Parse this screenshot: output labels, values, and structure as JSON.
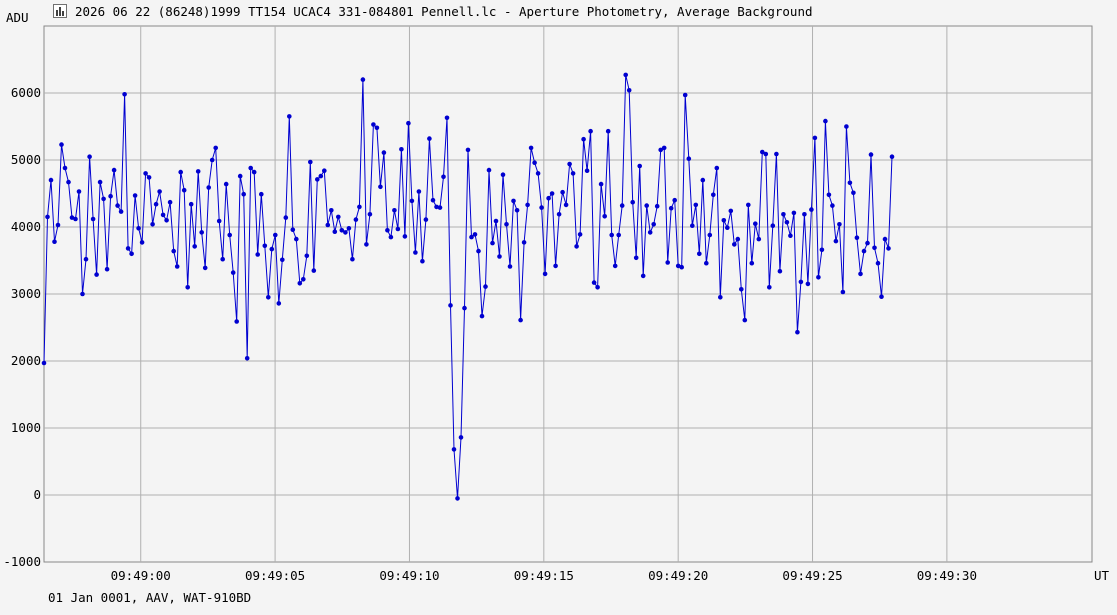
{
  "window": {
    "title": "2026 06 22 (86248)1999 TT154 UCAC4 331-084801 Pennell.lc - Aperture Photometry, Average Background",
    "icon": "chart-icon"
  },
  "footer": {
    "text": "01 Jan 0001, AAV, WAT-910BD"
  },
  "chart_data": {
    "type": "line",
    "ylabel": "ADU",
    "xlabel": "UT",
    "ylim": [
      -1000,
      7000
    ],
    "xlim": [
      "09:48:56.4",
      "09:49:35.4"
    ],
    "y_ticks": [
      -1000,
      0,
      1000,
      2000,
      3000,
      4000,
      5000,
      6000
    ],
    "x_ticks": [
      "09:49:00",
      "09:49:05",
      "09:49:10",
      "09:49:15",
      "09:49:20",
      "09:49:25",
      "09:49:30"
    ],
    "grid": true,
    "colors": {
      "series": "#0000d0",
      "grid": "#b0b0b0",
      "axis": "#808080",
      "background": "#f4f4f4"
    },
    "series": [
      {
        "x_start": "09:48:56.40",
        "x_step_seconds": 0.1304,
        "values": [
          1970,
          4150,
          4700,
          3780,
          4030,
          5230,
          4880,
          4670,
          4140,
          4120,
          4530,
          3000,
          3520,
          5050,
          4120,
          3290,
          4670,
          4420,
          3370,
          4460,
          4850,
          4320,
          4230,
          5980,
          3680,
          3600,
          4470,
          3980,
          3770,
          4800,
          4740,
          4040,
          4340,
          4530,
          4180,
          4100,
          4370,
          3640,
          3410,
          4820,
          4550,
          3100,
          4340,
          3710,
          4830,
          3920,
          3390,
          4590,
          5000,
          5180,
          4090,
          3520,
          4640,
          3880,
          3320,
          2590,
          4760,
          4490,
          2040,
          4880,
          4820,
          3590,
          4490,
          3720,
          2950,
          3670,
          3880,
          2860,
          3510,
          4140,
          5650,
          3960,
          3820,
          3160,
          3220,
          3570,
          4970,
          3350,
          4710,
          4760,
          4840,
          4030,
          4250,
          3930,
          4150,
          3950,
          3920,
          3980,
          3520,
          4110,
          4300,
          6200,
          3740,
          4190,
          5530,
          5480,
          4600,
          5110,
          3950,
          3850,
          4250,
          3970,
          5160,
          3860,
          5550,
          4390,
          3620,
          4530,
          3490,
          4110,
          5320,
          4400,
          4300,
          4290,
          4750,
          5630,
          2830,
          680,
          -50,
          860,
          2790,
          5150,
          3850,
          3890,
          3640,
          2670,
          3110,
          4850,
          3760,
          4090,
          3560,
          4780,
          4040,
          3410,
          4390,
          4250,
          2610,
          3770,
          4330,
          5180,
          4960,
          4800,
          4290,
          3300,
          4430,
          4500,
          3420,
          4190,
          4520,
          4330,
          4940,
          4800,
          3710,
          3890,
          5310,
          4840,
          5430,
          3170,
          3100,
          4640,
          4160,
          5430,
          3880,
          3420,
          3880,
          4320,
          6270,
          6040,
          4370,
          3540,
          4910,
          3270,
          4320,
          3920,
          4040,
          4310,
          5150,
          5180,
          3470,
          4280,
          4400,
          3420,
          3400,
          5970,
          5020,
          4020,
          4330,
          3600,
          4700,
          3460,
          3880,
          4480,
          4880,
          2950,
          4100,
          3990,
          4240,
          3740,
          3820,
          3070,
          2610,
          4330,
          3460,
          4050,
          3820,
          5120,
          5090,
          3100,
          4020,
          5090,
          3340,
          4190,
          4070,
          3870,
          4210,
          2430,
          3180,
          4190,
          3150,
          4260,
          5330,
          3250,
          3660,
          5580,
          4480,
          4320,
          3790,
          4040,
          3030,
          5500,
          4660,
          4510,
          3840,
          3300,
          3640,
          3760,
          5080,
          3690,
          3460,
          2960,
          3820,
          3680,
          5050
        ]
      }
    ]
  }
}
